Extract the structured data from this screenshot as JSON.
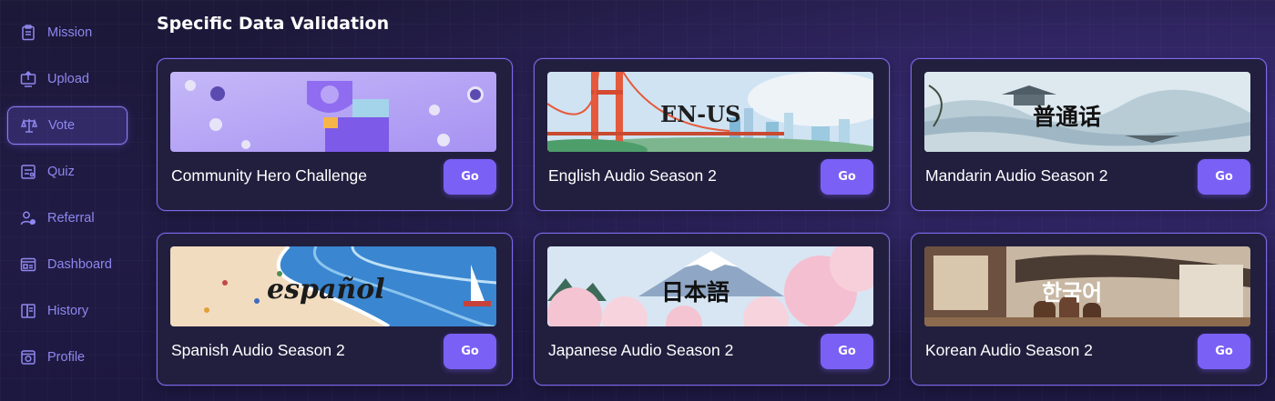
{
  "sidebar": {
    "items": [
      {
        "label": "Mission",
        "icon": "clipboard-icon"
      },
      {
        "label": "Upload",
        "icon": "upload-icon"
      },
      {
        "label": "Vote",
        "icon": "scales-icon",
        "active": true
      },
      {
        "label": "Quiz",
        "icon": "quiz-icon"
      },
      {
        "label": "Referral",
        "icon": "referral-icon"
      },
      {
        "label": "Dashboard",
        "icon": "dashboard-icon"
      },
      {
        "label": "History",
        "icon": "history-icon"
      },
      {
        "label": "Profile",
        "icon": "profile-icon"
      }
    ]
  },
  "main": {
    "title": "Specific Data Validation",
    "cards": [
      {
        "label": "Community Hero Challenge",
        "button": "Go",
        "banner_text": ""
      },
      {
        "label": "English Audio Season 2",
        "button": "Go",
        "banner_text": "EN-US"
      },
      {
        "label": "Mandarin Audio Season 2",
        "button": "Go",
        "banner_text": "普通话"
      },
      {
        "label": "Spanish Audio Season 2",
        "button": "Go",
        "banner_text": "español"
      },
      {
        "label": "Japanese Audio Season 2",
        "button": "Go",
        "banner_text": "日本語"
      },
      {
        "label": "Korean Audio Season 2",
        "button": "Go",
        "banner_text": "한국어"
      }
    ]
  },
  "colors": {
    "accent": "#7a60f5",
    "nav_text": "#8f87ee",
    "card_border": "#7c68e8",
    "card_bg": "#221e3e"
  }
}
